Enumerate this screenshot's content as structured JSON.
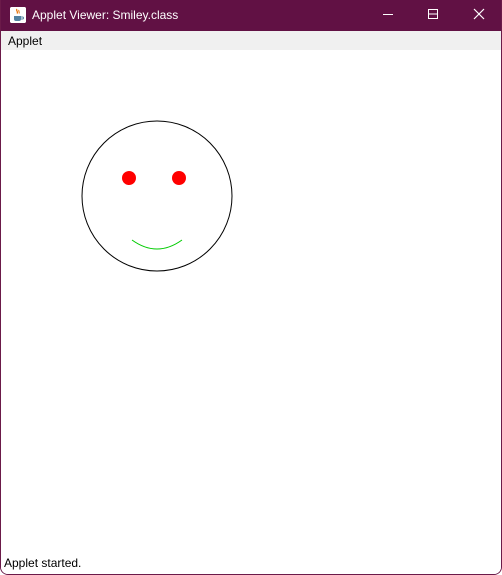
{
  "window": {
    "title": "Applet Viewer: Smiley.class",
    "titlebar_color": "#611144",
    "icon": "java-cup-icon",
    "controls": [
      "minimize-icon",
      "maximize-icon",
      "close-icon"
    ]
  },
  "menubar": {
    "items": [
      {
        "label": "Applet"
      }
    ]
  },
  "applet": {
    "drawing": "smiley-face",
    "face_outline_color": "#000000",
    "eye_color": "#ff0000",
    "smile_color": "#00cc00"
  },
  "status": {
    "text": "Applet started."
  }
}
